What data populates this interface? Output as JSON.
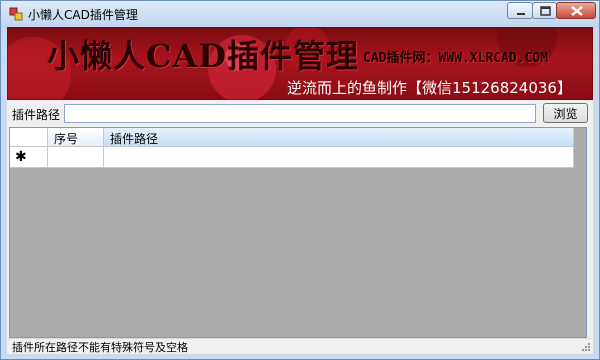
{
  "window": {
    "title": "小懒人CAD插件管理"
  },
  "banner": {
    "title": "小懒人CAD插件管理",
    "site": "CAD插件网：WWW.XLRCAD.COM",
    "author": "逆流而上的鱼制作【微信15126824036】",
    "accent": "#a8141c"
  },
  "form": {
    "path_label": "插件路径",
    "path_value": "",
    "browse_label": "浏览"
  },
  "grid": {
    "columns": [
      "序号",
      "插件路径"
    ],
    "new_row_marker": "✱",
    "empty_color": "#ababab"
  },
  "status": {
    "text": "插件所在路径不能有特殊符号及空格"
  },
  "icons": {
    "app": "cad-app-icon",
    "minimize": "minimize-icon",
    "maximize": "maximize-icon",
    "close": "close-icon",
    "grip": "resize-grip-icon"
  }
}
